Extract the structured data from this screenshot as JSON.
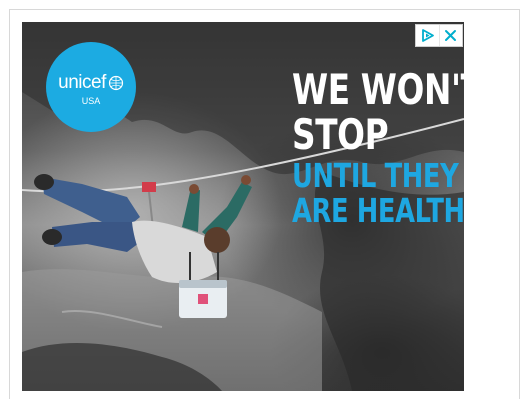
{
  "ad": {
    "advertiser": {
      "brand": "unicef",
      "region": "USA",
      "logo_icon": "unicef-emblem-icon",
      "logo_color": "#1cabe2"
    },
    "headline": {
      "line1": "WE WON'T",
      "line2": "STOP",
      "line3": "UNTIL THEY",
      "line4": "ARE HEALTHY",
      "text_color": "#ffffff",
      "accent_color": "#1ea7e1"
    },
    "controls": {
      "adchoices_icon": "adchoices-icon",
      "close_icon": "close-icon",
      "icon_color": "#00aecd"
    }
  }
}
